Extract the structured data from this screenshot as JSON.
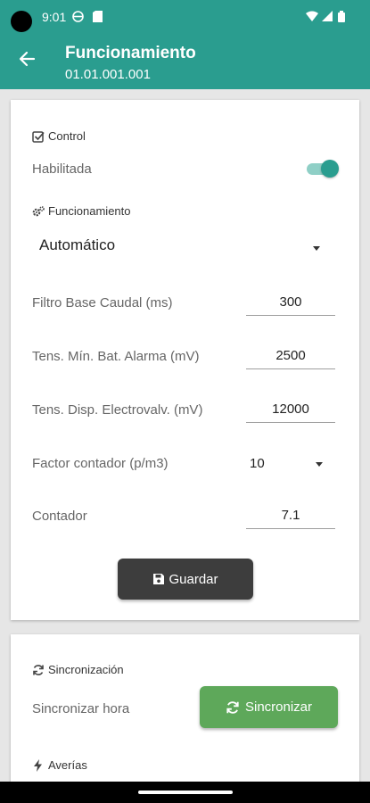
{
  "status": {
    "time": "9:01"
  },
  "header": {
    "title": "Funcionamiento",
    "subtitle": "01.01.001.001"
  },
  "control": {
    "section_title": "Control",
    "habilitada_label": "Habilitada",
    "habilitada_on": true
  },
  "funcionamiento": {
    "section_title": "Funcionamiento",
    "mode_value": "Automático",
    "fields": [
      {
        "label": "Filtro Base Caudal (ms)",
        "value": "300"
      },
      {
        "label": "Tens. Mín. Bat. Alarma (mV)",
        "value": "2500"
      },
      {
        "label": "Tens. Disp. Electrovalv. (mV)",
        "value": "12000"
      }
    ],
    "factor_label": "Factor contador (p/m3)",
    "factor_value": "10",
    "contador_label": "Contador",
    "contador_value": "7.1",
    "save_label": "Guardar"
  },
  "sync": {
    "section_title": "Sincronización",
    "hora_label": "Sincronizar hora",
    "button_label": "Sincronizar"
  },
  "averias": {
    "section_title": "Averías"
  },
  "colors": {
    "primary": "#2a9d8f",
    "save_button": "#3d3d3d",
    "sync_button": "#5ea85a"
  }
}
